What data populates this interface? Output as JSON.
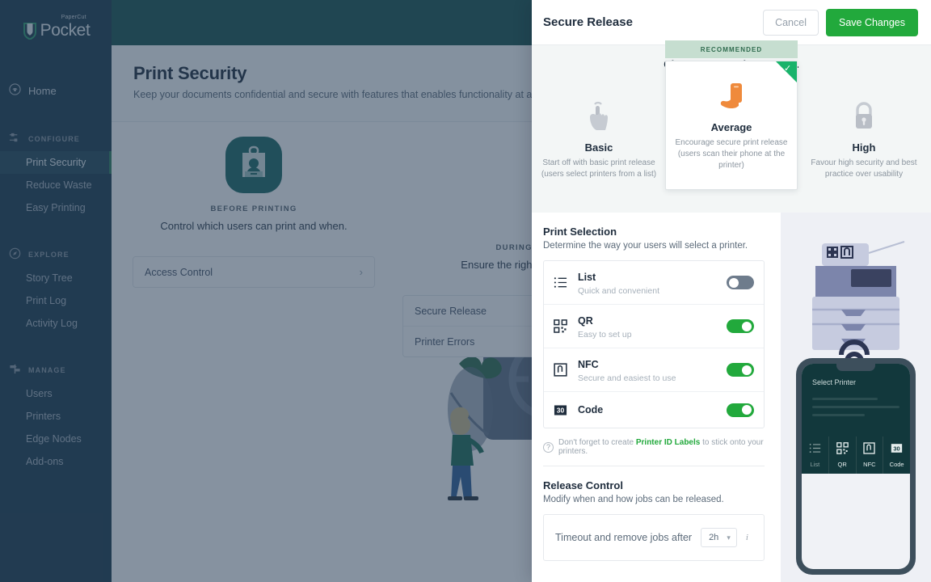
{
  "sidebar": {
    "logo": {
      "sub": "PaperCut",
      "word": "Pocket"
    },
    "home": {
      "label": "Home",
      "icon": "home-signal-icon"
    },
    "groups": [
      {
        "title": "CONFIGURE",
        "icon": "sliders-icon",
        "items": [
          {
            "label": "Print Security",
            "active": true
          },
          {
            "label": "Reduce Waste",
            "active": false
          },
          {
            "label": "Easy Printing",
            "active": false
          }
        ]
      },
      {
        "title": "EXPLORE",
        "icon": "compass-icon",
        "items": [
          {
            "label": "Story Tree",
            "active": false
          },
          {
            "label": "Print Log",
            "active": false
          },
          {
            "label": "Activity Log",
            "active": false
          }
        ]
      },
      {
        "title": "MANAGE",
        "icon": "signpost-icon",
        "items": [
          {
            "label": "Users",
            "active": false
          },
          {
            "label": "Printers",
            "active": false
          },
          {
            "label": "Edge Nodes",
            "active": false
          },
          {
            "label": "Add-ons",
            "active": false
          }
        ]
      }
    ]
  },
  "background_page": {
    "title": "Print Security",
    "subtitle": "Keep your documents confidential and secure with features that enables functionality at all pha",
    "columns": [
      {
        "kicker": "BEFORE PRINTING",
        "description": "Control which users can print and when.",
        "icon": "id-badge-icon",
        "rows": [
          {
            "label": "Access Control"
          }
        ]
      },
      {
        "kicker": "DURING PRI",
        "description": "Ensure the right jobs end u",
        "icon": "printer-icon",
        "rows": [
          {
            "label": "Secure Release"
          },
          {
            "label": "Printer Errors"
          }
        ]
      }
    ]
  },
  "panel": {
    "title": "Secure Release",
    "cancel_label": "Cancel",
    "save_label": "Save Changes",
    "preset_heading": "Choose a Security Preset...",
    "recommended_badge": "RECOMMENDED",
    "presets": [
      {
        "name": "Basic",
        "description": "Start off with basic print release (users select printers from a list)",
        "icon": "tap-hand-icon",
        "selected": false,
        "recommended": false
      },
      {
        "name": "Average",
        "description": "Encourage secure print release (users scan their phone at the printer)",
        "icon": "hand-phone-icon",
        "selected": true,
        "recommended": true
      },
      {
        "name": "High",
        "description": "Favour high security and best practice over usability",
        "icon": "padlock-icon",
        "selected": false,
        "recommended": false
      }
    ],
    "print_selection": {
      "title": "Print Selection",
      "subtitle": "Determine the way your users will select a printer.",
      "options": [
        {
          "name": "List",
          "description": "Quick and convenient",
          "icon": "list-icon",
          "enabled": false
        },
        {
          "name": "QR",
          "description": "Easy to set up",
          "icon": "qr-code-icon",
          "enabled": true
        },
        {
          "name": "NFC",
          "description": "Secure and easiest to use",
          "icon": "nfc-icon",
          "enabled": true
        },
        {
          "name": "Code",
          "description": "",
          "icon": "numeric-code-icon",
          "enabled": true
        }
      ],
      "hint_prefix": "Don't forget to create ",
      "hint_link": "Printer ID Labels",
      "hint_suffix": " to stick onto your printers.",
      "hint_icon": "question-circle-icon"
    },
    "release_control": {
      "title": "Release Control",
      "subtitle": "Modify when and how jobs can be released.",
      "timeout_label": "Timeout and remove jobs after",
      "timeout_value": "2h",
      "timeout_options": [
        "2h"
      ],
      "info_icon": "info-italic-icon"
    },
    "preview": {
      "printer_icon": "printer-illustration",
      "phone_screen_title": "Select Printer",
      "tabs": [
        {
          "label": "List",
          "icon": "list-icon",
          "active": false
        },
        {
          "label": "QR",
          "icon": "qr-code-icon",
          "active": true
        },
        {
          "label": "NFC",
          "icon": "nfc-icon",
          "active": true
        },
        {
          "label": "Code",
          "icon": "numeric-code-icon",
          "active": true
        }
      ]
    }
  },
  "colors": {
    "brand_green": "#22a93c",
    "recommended_teal": "#19b36b",
    "sidebar": "#1b3a4b",
    "topbar": "#18524f",
    "accent_orange": "#ef8a3c",
    "panel_preview_bg": "#eef0f5"
  }
}
